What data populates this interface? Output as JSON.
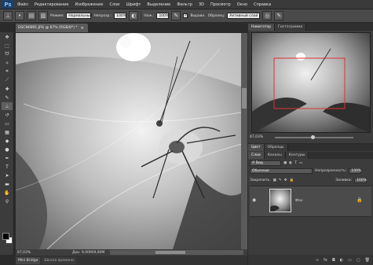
{
  "app": {
    "logo": "Ps"
  },
  "menu": [
    "Файл",
    "Редактирование",
    "Изображение",
    "Слои",
    "Шрифт",
    "Выделение",
    "Фильтр",
    "3D",
    "Просмотр",
    "Окно",
    "Справка"
  ],
  "options": {
    "mode_label": "Режим:",
    "mode_value": "Нормальный",
    "opacity_label": "Непрозр.:",
    "opacity_value": "100%",
    "pressure_label": "Наж.:",
    "pressure_value": "100%",
    "aligned_label": "Выравн.",
    "sample_label": "Образец:",
    "sample_value": "Активный слой"
  },
  "document": {
    "tab_title": "DSCN0891.JPG @ 67% (RGB/8*) *",
    "zoom": "67,03%",
    "info": "Док: 9,00M/9,00M"
  },
  "bottom_tabs": [
    "Mini Bridge",
    "Шкала времени"
  ],
  "navigator": {
    "tabs": [
      "Навигатор",
      "Гистограмма"
    ],
    "zoom": "67,03%"
  },
  "layers_panel": {
    "tabs": [
      "Цвет",
      "Образцы"
    ],
    "subtabs": [
      "Слои",
      "Каналы",
      "Контуры"
    ],
    "filter_label": "Вид",
    "blend_mode": "Обычные",
    "opacity_label": "Непрозрачность:",
    "opacity_value": "100%",
    "lock_label": "Закрепить:",
    "fill_label": "Заливка:",
    "fill_value": "100%",
    "layer_name": "Фон"
  },
  "colors": {
    "foreground": "#000000",
    "background": "#ffffff"
  }
}
